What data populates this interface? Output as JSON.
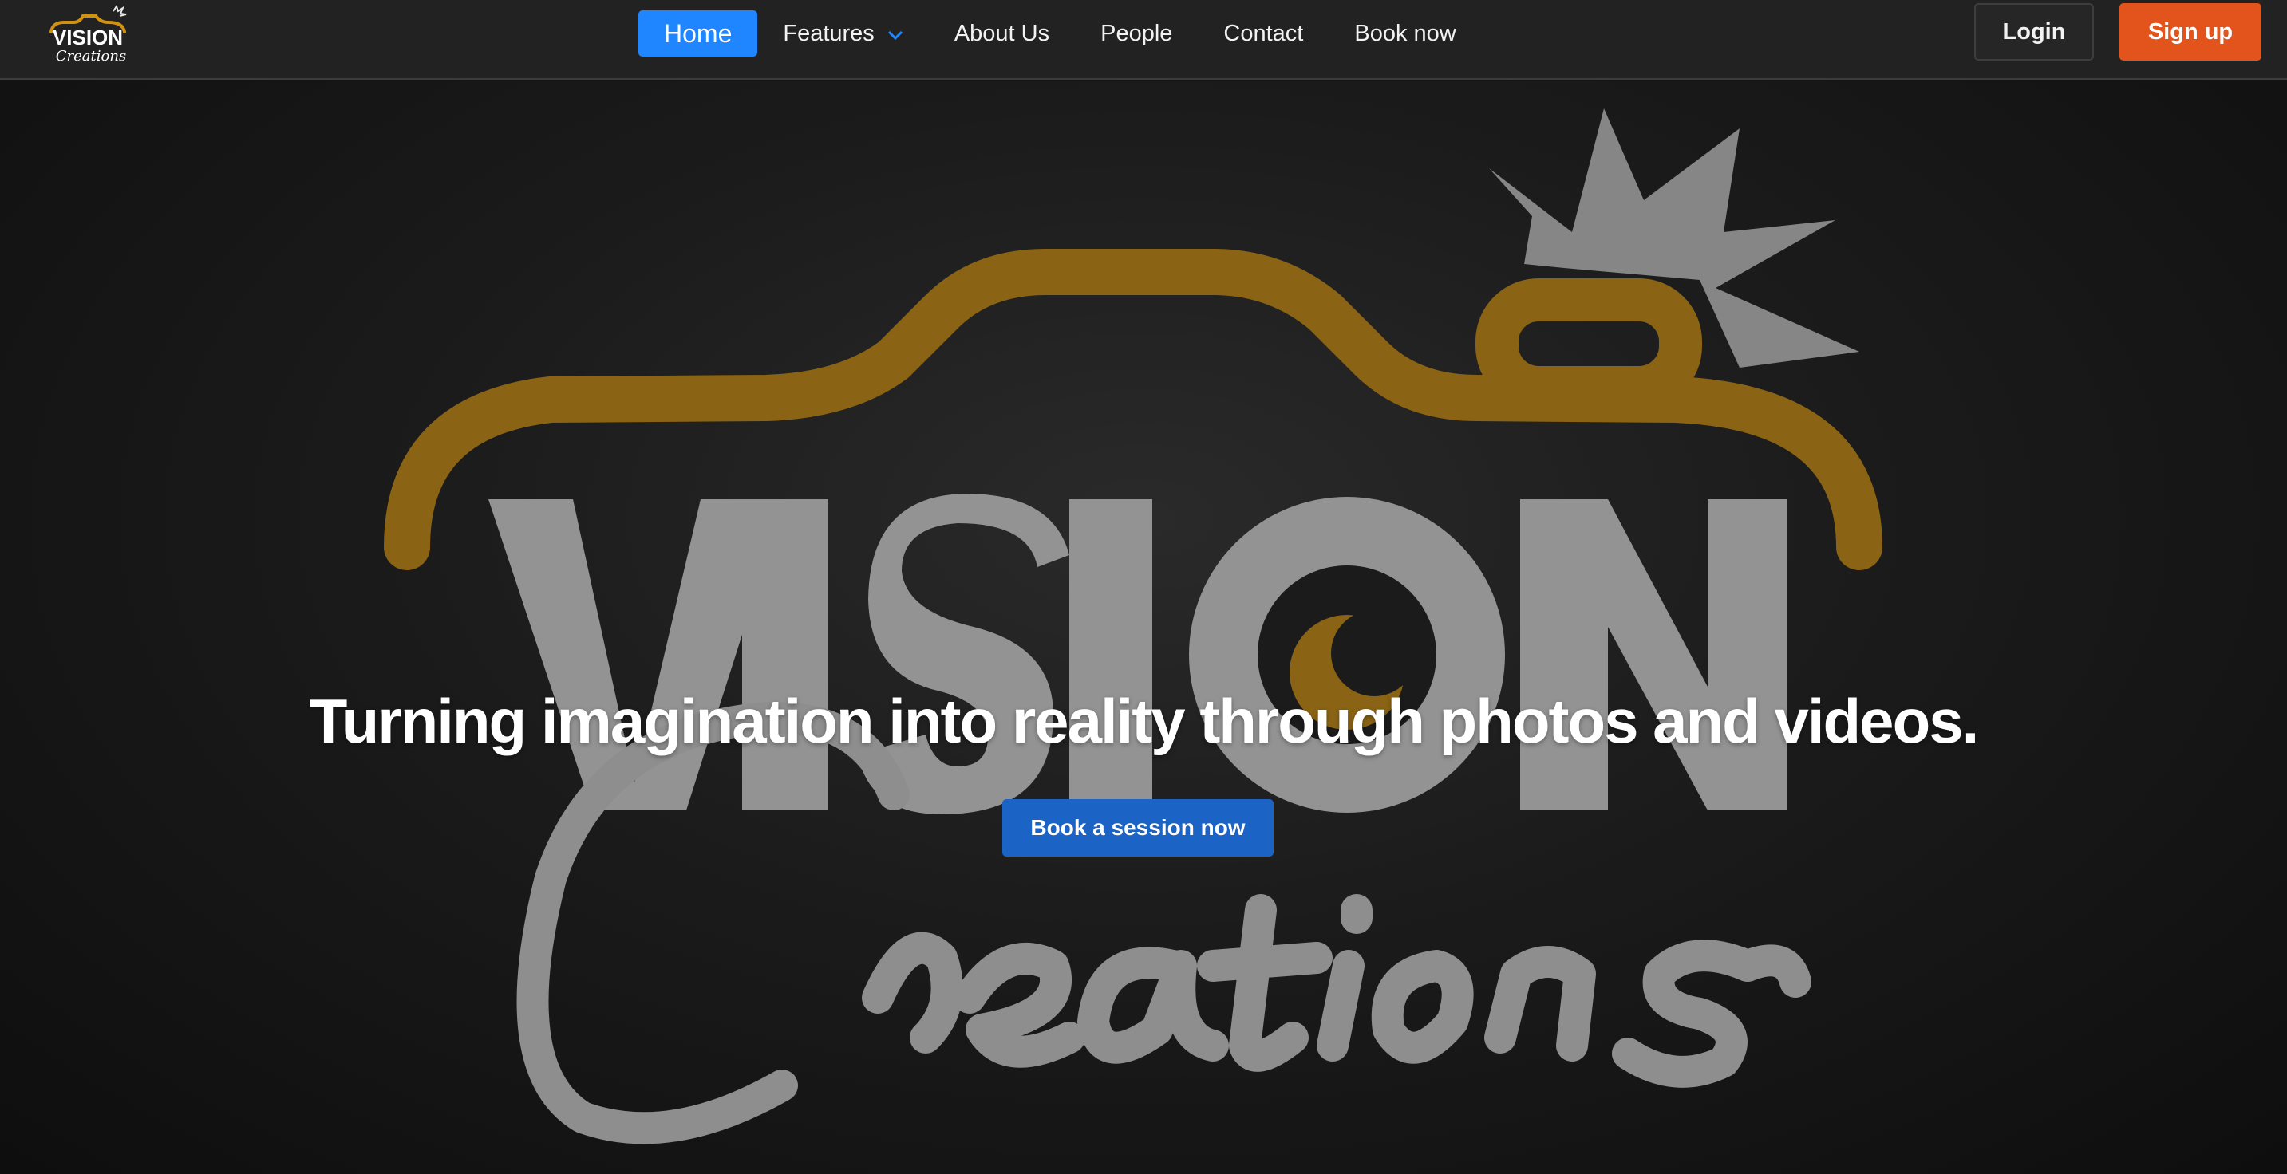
{
  "brand": {
    "logo_line1": "VISION",
    "logo_line2": "Creations",
    "logo_icon": "camera-logo-icon",
    "accent_gold": "#8a6414",
    "text_gray": "#9a9a9a"
  },
  "nav": {
    "items": [
      {
        "label": "Home",
        "active": true
      },
      {
        "label": "Features",
        "has_dropdown": true
      },
      {
        "label": "About Us"
      },
      {
        "label": "People"
      },
      {
        "label": "Contact"
      },
      {
        "label": "Book now"
      }
    ],
    "active_color": "#1f86ff",
    "dropdown_icon": "chevron-down-icon"
  },
  "auth": {
    "login_label": "Login",
    "signup_label": "Sign up",
    "signup_color": "#e2541b"
  },
  "hero": {
    "tagline": "Turning imagination into reality through photos and videos.",
    "cta_label": "Book a session now",
    "cta_color": "#1b63c4",
    "background_art": {
      "word_main": "VISION",
      "word_script": "Creations"
    }
  }
}
